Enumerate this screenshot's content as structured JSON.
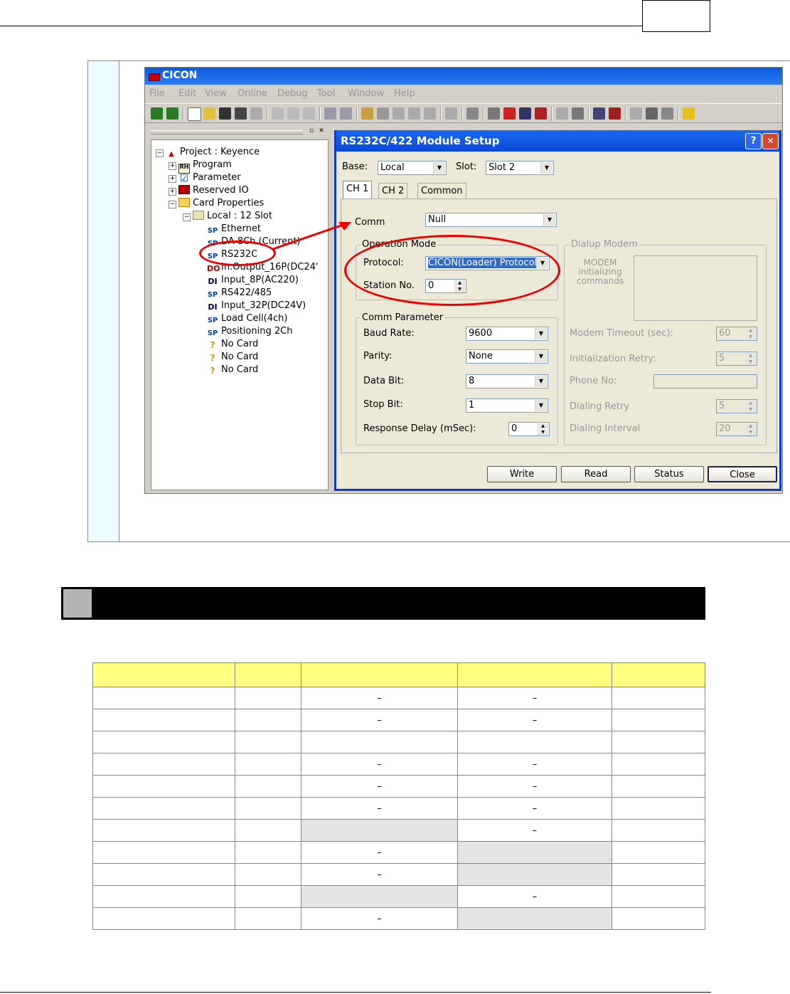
{
  "app": {
    "title": "CICON"
  },
  "menu": [
    "File",
    "Edit",
    "View",
    "Online",
    "Debug",
    "Tool",
    "Window",
    "Help"
  ],
  "tree": {
    "nodes": [
      {
        "label": "Project : Keyence",
        "icon": "project-icon"
      },
      {
        "label": "Program",
        "icon": "program-icon"
      },
      {
        "label": "Parameter",
        "icon": "parameter-icon"
      },
      {
        "label": "Reserved IO",
        "icon": "reserved-io-icon"
      },
      {
        "label": "Card Properties",
        "icon": "folder-icon"
      },
      {
        "label": "Local : 12 Slot",
        "icon": "slot-folder-icon"
      },
      {
        "label": "Ethernet",
        "icon": "SP"
      },
      {
        "label": "DA 8Ch (Current)",
        "icon": "SP"
      },
      {
        "label": "RS232C",
        "icon": "SP"
      },
      {
        "label": "In.Output_16P(DC24'",
        "icon": "DO"
      },
      {
        "label": "Input_8P(AC220)",
        "icon": "DI"
      },
      {
        "label": "RS422/485",
        "icon": "SP"
      },
      {
        "label": "Input_32P(DC24V)",
        "icon": "DI"
      },
      {
        "label": "Load Cell(4ch)",
        "icon": "SP"
      },
      {
        "label": "Positioning 2Ch",
        "icon": "SP"
      },
      {
        "label": "No Card",
        "icon": "?"
      },
      {
        "label": "No Card",
        "icon": "?"
      },
      {
        "label": "No Card",
        "icon": "?"
      }
    ]
  },
  "dialog": {
    "title": "RS232C/422 Module Setup",
    "help": "?",
    "close": "✕",
    "base_label": "Base:",
    "base_value": "Local",
    "slot_label": "Slot:",
    "slot_value": "Slot 2",
    "tabs": [
      "CH 1",
      "CH 2",
      "Common"
    ],
    "comm_label": "Comm",
    "comm_value": "Null",
    "operation_mode": {
      "title": "Operation Mode",
      "protocol_label": "Protocol:",
      "protocol_value": "CICON(Loader) Protocol",
      "station_label": "Station No.",
      "station_value": "0"
    },
    "comm_parameter": {
      "title": "Comm Parameter",
      "baud_label": "Baud Rate:",
      "baud_value": "9600",
      "parity_label": "Parity:",
      "parity_value": "None",
      "databit_label": "Data Bit:",
      "databit_value": "8",
      "stopbit_label": "Stop Bit:",
      "stopbit_value": "1",
      "delay_label": "Response Delay (mSec):",
      "delay_value": "0"
    },
    "dialup": {
      "title": "Dialup Modem",
      "init_label": "MODEM initializing commands",
      "timeout_label": "Modem Timeout  (sec):",
      "timeout_value": "60",
      "retry_label": "Initialization Retry:",
      "retry_value": "5",
      "phone_label": "Phone No:",
      "phone_value": "",
      "dial_retry_label": "Dialing Retry",
      "dial_retry_value": "5",
      "dial_interval_label": "Dialing Interval",
      "dial_interval_value": "20"
    },
    "buttons": {
      "write": "Write",
      "read": "Read",
      "status": "Status",
      "close": "Close"
    }
  },
  "table": {
    "dash": "–",
    "rows": [
      [
        "",
        "",
        "",
        "",
        ""
      ],
      [
        "",
        "",
        "–",
        "–",
        ""
      ],
      [
        "",
        "",
        "–",
        "–",
        ""
      ],
      [
        "",
        "",
        "",
        "",
        ""
      ],
      [
        "",
        "",
        "–",
        "–",
        ""
      ],
      [
        "",
        "",
        "–",
        "–",
        ""
      ],
      [
        "",
        "",
        "–",
        "–",
        ""
      ],
      [
        "",
        "",
        "",
        "–",
        ""
      ],
      [
        "",
        "",
        "–",
        "",
        ""
      ],
      [
        "",
        "",
        "–",
        "",
        ""
      ],
      [
        "",
        "",
        "",
        "–",
        ""
      ],
      [
        "",
        "",
        "–",
        "",
        ""
      ]
    ]
  }
}
